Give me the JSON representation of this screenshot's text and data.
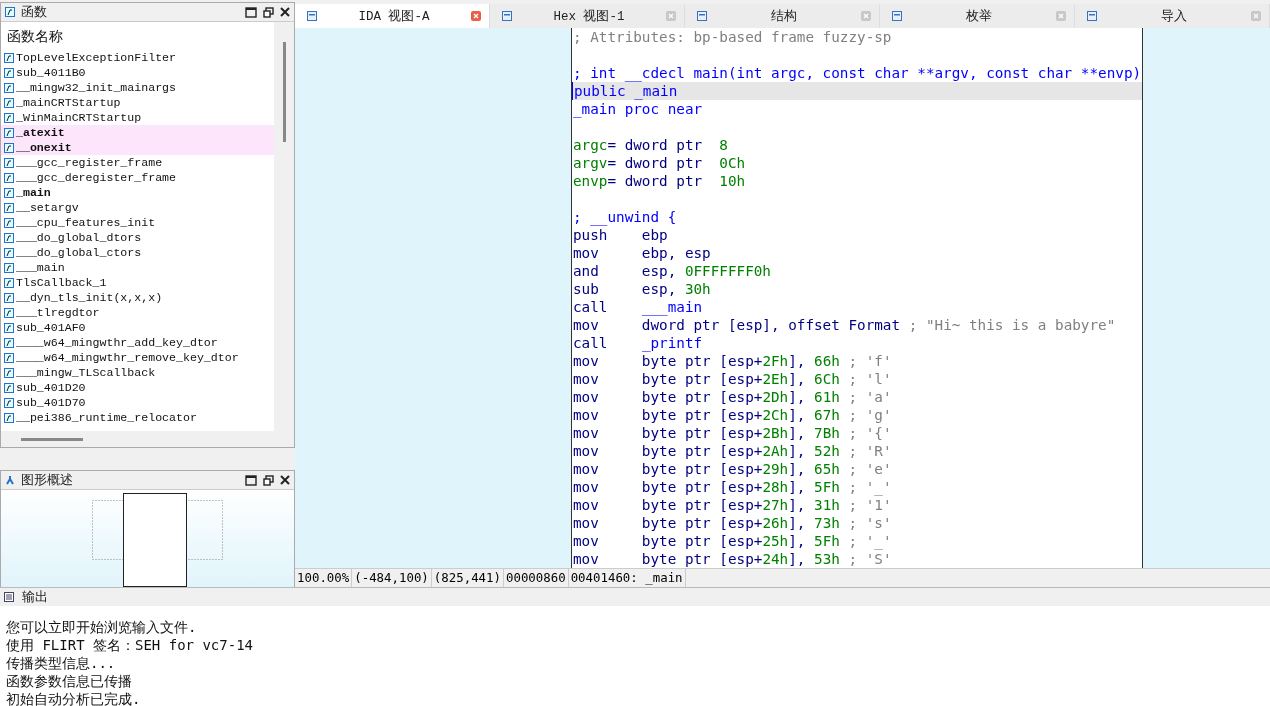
{
  "functions_panel": {
    "title": "函数",
    "column_header": "函数名称",
    "items": [
      {
        "name": "TopLevelExceptionFilter",
        "selected": false,
        "bold": false
      },
      {
        "name": "sub_4011B0",
        "selected": false,
        "bold": false
      },
      {
        "name": "__mingw32_init_mainargs",
        "selected": false,
        "bold": false
      },
      {
        "name": "_mainCRTStartup",
        "selected": false,
        "bold": false
      },
      {
        "name": "_WinMainCRTStartup",
        "selected": false,
        "bold": false
      },
      {
        "name": "_atexit",
        "selected": true,
        "bold": true
      },
      {
        "name": "__onexit",
        "selected": true,
        "bold": true
      },
      {
        "name": "___gcc_register_frame",
        "selected": false,
        "bold": false
      },
      {
        "name": "___gcc_deregister_frame",
        "selected": false,
        "bold": false
      },
      {
        "name": "_main",
        "selected": false,
        "bold": true
      },
      {
        "name": "__setargv",
        "selected": false,
        "bold": false
      },
      {
        "name": "___cpu_features_init",
        "selected": false,
        "bold": false
      },
      {
        "name": "___do_global_dtors",
        "selected": false,
        "bold": false
      },
      {
        "name": "___do_global_ctors",
        "selected": false,
        "bold": false
      },
      {
        "name": "___main",
        "selected": false,
        "bold": false
      },
      {
        "name": "TlsCallback_1",
        "selected": false,
        "bold": false
      },
      {
        "name": "__dyn_tls_init(x,x,x)",
        "selected": false,
        "bold": false
      },
      {
        "name": "___tlregdtor",
        "selected": false,
        "bold": false
      },
      {
        "name": "sub_401AF0",
        "selected": false,
        "bold": false
      },
      {
        "name": "____w64_mingwthr_add_key_dtor",
        "selected": false,
        "bold": false
      },
      {
        "name": "____w64_mingwthr_remove_key_dtor",
        "selected": false,
        "bold": false
      },
      {
        "name": "___mingw_TLScallback",
        "selected": false,
        "bold": false
      },
      {
        "name": "sub_401D20",
        "selected": false,
        "bold": false
      },
      {
        "name": "sub_401D70",
        "selected": false,
        "bold": false
      },
      {
        "name": "__pei386_runtime_relocator",
        "selected": false,
        "bold": false
      }
    ]
  },
  "graph_overview": {
    "title": "图形概述"
  },
  "tabs": [
    {
      "label": "IDA 视图-A",
      "selected": true
    },
    {
      "label": "Hex 视图-1",
      "selected": false
    },
    {
      "label": "结构",
      "selected": false
    },
    {
      "label": "枚举",
      "selected": false
    },
    {
      "label": "导入",
      "selected": false
    }
  ],
  "code_lines": [
    {
      "selected": false,
      "segments": [
        {
          "kind": "comment",
          "text": "; Attributes: bp-based frame fuzzy-sp"
        }
      ]
    },
    {
      "selected": false
    },
    {
      "selected": false,
      "segments": [
        {
          "kind": "name",
          "text": "; int __cdecl main(int argc, const char **argv, const char **envp)"
        }
      ]
    },
    {
      "selected": true,
      "segments": [
        {
          "kind": "name",
          "text": "public _main"
        }
      ]
    },
    {
      "selected": false,
      "segments": [
        {
          "kind": "name",
          "text": "_main proc near"
        }
      ]
    },
    {
      "selected": false
    },
    {
      "selected": false,
      "segments": [
        {
          "kind": "number",
          "text": "argc"
        },
        {
          "kind": "plain",
          "text": "= dword ptr  "
        },
        {
          "kind": "number",
          "text": "8"
        }
      ]
    },
    {
      "selected": false,
      "segments": [
        {
          "kind": "number",
          "text": "argv"
        },
        {
          "kind": "plain",
          "text": "= dword ptr  "
        },
        {
          "kind": "number",
          "text": "0Ch"
        }
      ]
    },
    {
      "selected": false,
      "segments": [
        {
          "kind": "number",
          "text": "envp"
        },
        {
          "kind": "plain",
          "text": "= dword ptr  "
        },
        {
          "kind": "number",
          "text": "10h"
        }
      ]
    },
    {
      "selected": false
    },
    {
      "selected": false,
      "segments": [
        {
          "kind": "name",
          "text": "; __unwind {"
        }
      ]
    },
    {
      "selected": false,
      "segments": [
        {
          "kind": "plain",
          "text": "push    ebp"
        }
      ]
    },
    {
      "selected": false,
      "segments": [
        {
          "kind": "plain",
          "text": "mov     ebp, esp"
        }
      ]
    },
    {
      "selected": false,
      "segments": [
        {
          "kind": "plain",
          "text": "and     esp, "
        },
        {
          "kind": "number",
          "text": "0FFFFFFF0h"
        }
      ]
    },
    {
      "selected": false,
      "segments": [
        {
          "kind": "plain",
          "text": "sub     esp, "
        },
        {
          "kind": "number",
          "text": "30h"
        }
      ]
    },
    {
      "selected": false,
      "segments": [
        {
          "kind": "plain",
          "text": "call    "
        },
        {
          "kind": "name",
          "text": "___main"
        }
      ]
    },
    {
      "selected": false,
      "segments": [
        {
          "kind": "plain",
          "text": "mov     dword ptr [esp], offset Format "
        },
        {
          "kind": "comment",
          "text": "; \"Hi~ this is a babyre\""
        }
      ]
    },
    {
      "selected": false,
      "segments": [
        {
          "kind": "plain",
          "text": "call    "
        },
        {
          "kind": "name",
          "text": "_printf"
        }
      ]
    },
    {
      "selected": false,
      "segments": [
        {
          "kind": "plain",
          "text": "mov     byte ptr [esp+"
        },
        {
          "kind": "number",
          "text": "2Fh"
        },
        {
          "kind": "plain",
          "text": "], "
        },
        {
          "kind": "number",
          "text": "66h"
        },
        {
          "kind": "comment",
          "text": " ; 'f'"
        }
      ]
    },
    {
      "selected": false,
      "segments": [
        {
          "kind": "plain",
          "text": "mov     byte ptr [esp+"
        },
        {
          "kind": "number",
          "text": "2Eh"
        },
        {
          "kind": "plain",
          "text": "], "
        },
        {
          "kind": "number",
          "text": "6Ch"
        },
        {
          "kind": "comment",
          "text": " ; 'l'"
        }
      ]
    },
    {
      "selected": false,
      "segments": [
        {
          "kind": "plain",
          "text": "mov     byte ptr [esp+"
        },
        {
          "kind": "number",
          "text": "2Dh"
        },
        {
          "kind": "plain",
          "text": "], "
        },
        {
          "kind": "number",
          "text": "61h"
        },
        {
          "kind": "comment",
          "text": " ; 'a'"
        }
      ]
    },
    {
      "selected": false,
      "segments": [
        {
          "kind": "plain",
          "text": "mov     byte ptr [esp+"
        },
        {
          "kind": "number",
          "text": "2Ch"
        },
        {
          "kind": "plain",
          "text": "], "
        },
        {
          "kind": "number",
          "text": "67h"
        },
        {
          "kind": "comment",
          "text": " ; 'g'"
        }
      ]
    },
    {
      "selected": false,
      "segments": [
        {
          "kind": "plain",
          "text": "mov     byte ptr [esp+"
        },
        {
          "kind": "number",
          "text": "2Bh"
        },
        {
          "kind": "plain",
          "text": "], "
        },
        {
          "kind": "number",
          "text": "7Bh"
        },
        {
          "kind": "comment",
          "text": " ; '{'"
        }
      ]
    },
    {
      "selected": false,
      "segments": [
        {
          "kind": "plain",
          "text": "mov     byte ptr [esp+"
        },
        {
          "kind": "number",
          "text": "2Ah"
        },
        {
          "kind": "plain",
          "text": "], "
        },
        {
          "kind": "number",
          "text": "52h"
        },
        {
          "kind": "comment",
          "text": " ; 'R'"
        }
      ]
    },
    {
      "selected": false,
      "segments": [
        {
          "kind": "plain",
          "text": "mov     byte ptr [esp+"
        },
        {
          "kind": "number",
          "text": "29h"
        },
        {
          "kind": "plain",
          "text": "], "
        },
        {
          "kind": "number",
          "text": "65h"
        },
        {
          "kind": "comment",
          "text": " ; 'e'"
        }
      ]
    },
    {
      "selected": false,
      "segments": [
        {
          "kind": "plain",
          "text": "mov     byte ptr [esp+"
        },
        {
          "kind": "number",
          "text": "28h"
        },
        {
          "kind": "plain",
          "text": "], "
        },
        {
          "kind": "number",
          "text": "5Fh"
        },
        {
          "kind": "comment",
          "text": " ; '_'"
        }
      ]
    },
    {
      "selected": false,
      "segments": [
        {
          "kind": "plain",
          "text": "mov     byte ptr [esp+"
        },
        {
          "kind": "number",
          "text": "27h"
        },
        {
          "kind": "plain",
          "text": "], "
        },
        {
          "kind": "number",
          "text": "31h"
        },
        {
          "kind": "comment",
          "text": " ; '1'"
        }
      ]
    },
    {
      "selected": false,
      "segments": [
        {
          "kind": "plain",
          "text": "mov     byte ptr [esp+"
        },
        {
          "kind": "number",
          "text": "26h"
        },
        {
          "kind": "plain",
          "text": "], "
        },
        {
          "kind": "number",
          "text": "73h"
        },
        {
          "kind": "comment",
          "text": " ; 's'"
        }
      ]
    },
    {
      "selected": false,
      "segments": [
        {
          "kind": "plain",
          "text": "mov     byte ptr [esp+"
        },
        {
          "kind": "number",
          "text": "25h"
        },
        {
          "kind": "plain",
          "text": "], "
        },
        {
          "kind": "number",
          "text": "5Fh"
        },
        {
          "kind": "comment",
          "text": " ; '_'"
        }
      ]
    },
    {
      "selected": false,
      "segments": [
        {
          "kind": "plain",
          "text": "mov     byte ptr [esp+"
        },
        {
          "kind": "number",
          "text": "24h"
        },
        {
          "kind": "plain",
          "text": "], "
        },
        {
          "kind": "number",
          "text": "53h"
        },
        {
          "kind": "comment",
          "text": " ; 'S'"
        }
      ]
    }
  ],
  "status_bar": [
    "100.00%",
    "(-484,100)",
    "(825,441)",
    "00000860",
    "00401460: _main"
  ],
  "output_panel": {
    "title": "输出",
    "lines": [
      "您可以立即开始浏览输入文件.",
      "使用 FLIRT 签名：SEH for vc7-14",
      "传播类型信息...",
      "函数参数信息已传播",
      "初始自动分析已完成."
    ]
  }
}
